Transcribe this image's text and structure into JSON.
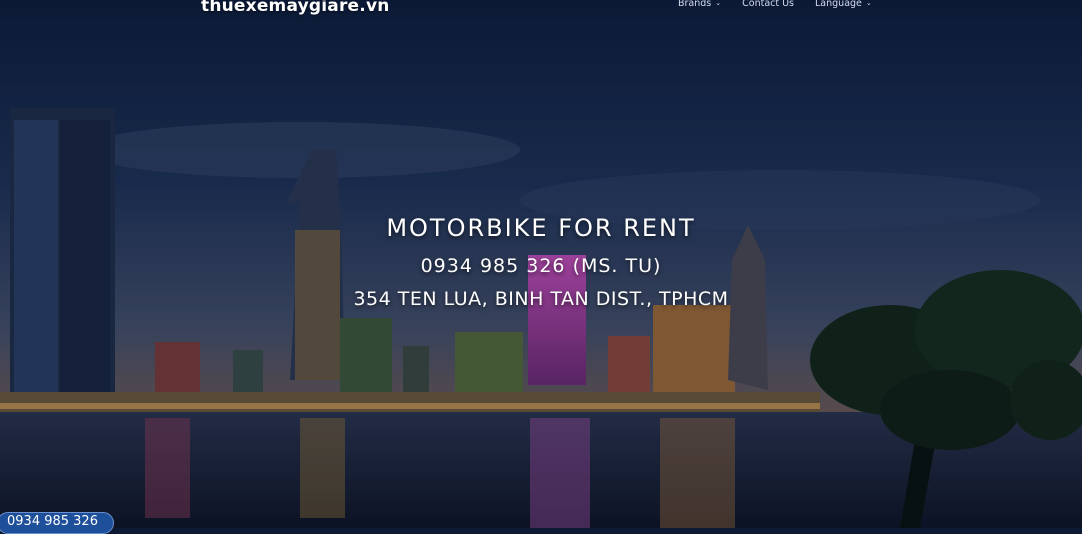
{
  "site": {
    "logo_text": "thuexemaygiare.vn"
  },
  "nav": {
    "items": [
      {
        "label": "Brands",
        "has_dropdown": true
      },
      {
        "label": "Contact Us",
        "has_dropdown": false
      },
      {
        "label": "Language",
        "has_dropdown": true
      }
    ]
  },
  "hero": {
    "title": "MOTORBIKE FOR RENT",
    "phone": "0934 985 326 (MS. TU)",
    "address": "354 TEN LUA, BINH TAN DIST., TPHCM"
  },
  "floating": {
    "phone_badge": "0934 985 326"
  },
  "icons": {
    "dropdown": "chevron-down-icon"
  },
  "colors": {
    "sky_top": "#0e1e3d",
    "sky_mid": "#2c3c63",
    "badge": "#1d4f9b",
    "text": "#ffffff"
  }
}
